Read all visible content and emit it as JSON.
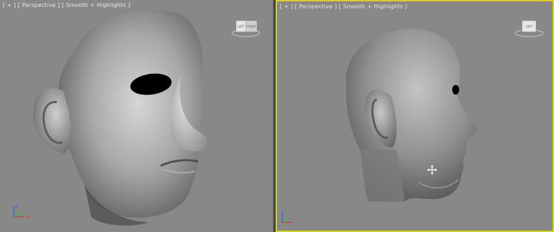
{
  "viewports": [
    {
      "name": "left",
      "label_menu": "[ + ]",
      "label_view": "[ Perspective ]",
      "label_shading": "[ Smooth + Highlights ]",
      "viewcube_faces": [
        "LEFT",
        "FRONT"
      ],
      "gizmo_axes": [
        "z",
        "y",
        "x"
      ],
      "active": false
    },
    {
      "name": "right",
      "label_menu": "[ + ]",
      "label_view": "[ Perspective ]",
      "label_shading": "[ Smooth + Highlights ]",
      "viewcube_faces": [
        "LEFT"
      ],
      "active": true
    }
  ],
  "colors": {
    "viewport_bg": "#888888",
    "active_border": "#d8d21e",
    "label_text": "#eaeaea",
    "axis_x": "#e03030",
    "axis_y": "#30c030",
    "axis_z": "#3060e0"
  },
  "icons": [
    "viewcube-icon",
    "axis-gizmo-icon",
    "move-cursor-icon"
  ]
}
